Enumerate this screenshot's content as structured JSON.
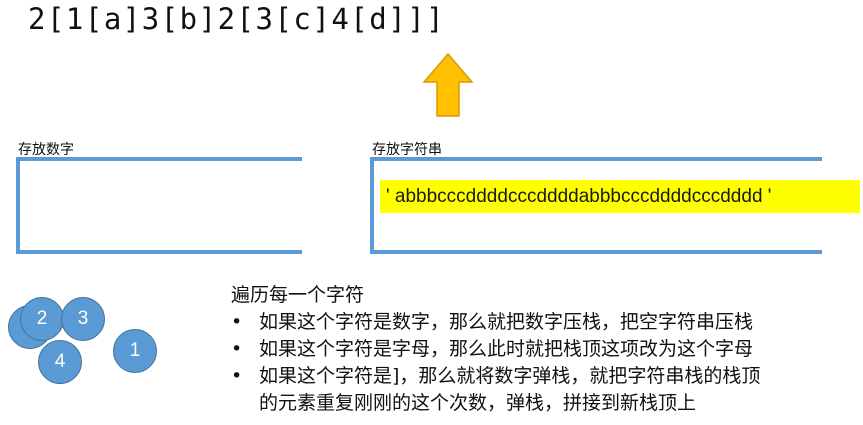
{
  "expression": "2[1[a]3[b]2[3[c]4[d]]]",
  "arrow_color": "#ffc000",
  "stack_color": "#5b9bd5",
  "highlight_color": "#ffff00",
  "number_stack": {
    "label": "存放数字"
  },
  "string_stack": {
    "label": "存放字符串",
    "content": "' abbbcccddddcccddddabbbcccddddcccdddd '"
  },
  "circles": [
    {
      "label": ""
    },
    {
      "label": "2"
    },
    {
      "label": "3"
    },
    {
      "label": "4"
    },
    {
      "label": "1"
    }
  ],
  "description": {
    "title": "遍历每一个字符",
    "bullet_marker": "•",
    "bullets": [
      "如果这个字符是数字，那么就把数字压栈，把空字符串压栈",
      "如果这个字符是字母，那么此时就把栈顶这项改为这个字母",
      "如果这个字符是]，那么就将数字弹栈，就把字符串栈的栈顶\n的元素重复刚刚的这个次数，弹栈，拼接到新栈顶上"
    ]
  }
}
